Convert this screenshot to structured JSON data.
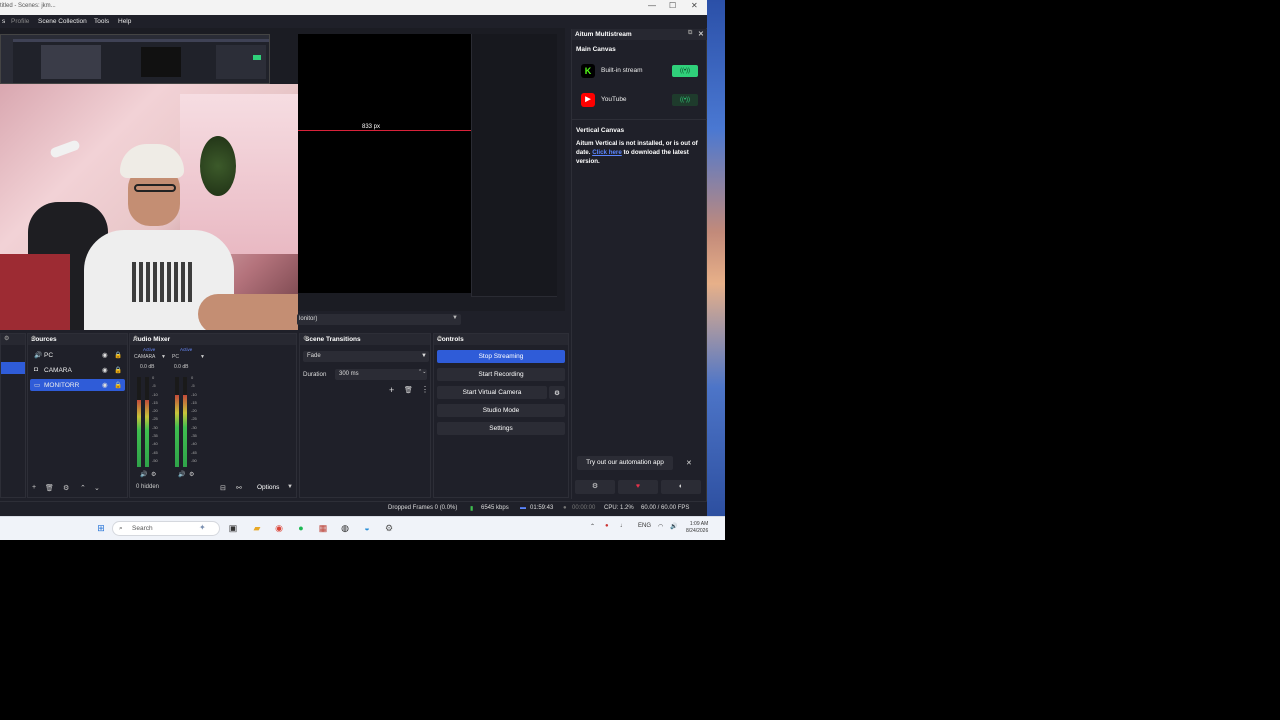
{
  "window": {
    "title": "titled - Scenes: jkm...",
    "controls": [
      "—",
      "☐",
      "✕"
    ]
  },
  "menu": {
    "profile": "Profile",
    "scene_collection": "Scene Collection",
    "tools": "Tools",
    "help": "Help"
  },
  "preview": {
    "px_label": "833 px",
    "monitor_select": "lonitor)"
  },
  "sources": {
    "title": "Sources",
    "items": [
      {
        "icon": "speaker-icon",
        "label": "PC"
      },
      {
        "icon": "camera-icon",
        "label": "CAMARA"
      },
      {
        "icon": "monitor-icon",
        "label": "MONITORR"
      }
    ]
  },
  "mixer": {
    "title": "Audio Mixer",
    "channels": [
      {
        "name": "CAMARA",
        "status": "Active",
        "db": "0.0 dB",
        "level": 0.75
      },
      {
        "name": "PC",
        "status": "Active",
        "db": "0.0 dB",
        "level": 0.8
      }
    ],
    "ticks": [
      "0",
      "-5",
      "-10",
      "-15",
      "-20",
      "-25",
      "-30",
      "-35",
      "-40",
      "-45",
      "-50",
      "-55",
      "-60"
    ],
    "hidden_label": "0 hidden",
    "options_label": "Options"
  },
  "transitions": {
    "title": "Scene Transitions",
    "type": "Fade",
    "duration_label": "Duration",
    "duration_value": "300 ms"
  },
  "controls": {
    "title": "Controls",
    "stop_streaming": "Stop Streaming",
    "start_recording": "Start Recording",
    "start_virtual_camera": "Start Virtual Camera",
    "studio_mode": "Studio Mode",
    "settings": "Settings"
  },
  "aitum": {
    "title": "Aitum Multistream",
    "main_canvas": "Main Canvas",
    "platforms": [
      {
        "icon": "kick-icon",
        "name": "Built-in stream",
        "toggle_color": "#2fd07a"
      },
      {
        "icon": "youtube-icon",
        "name": "YouTube",
        "toggle_color": "#1e3b2c"
      }
    ],
    "vertical_canvas": "Vertical Canvas",
    "vc_notice": "Aitum Vertical is not installed, or is out of date.",
    "vc_link": "Click here",
    "vc_tail": "to download the latest version.",
    "automation": "Try out our automation app"
  },
  "status": {
    "dropped_frames": "Dropped Frames 0 (0.0%)",
    "bitrate": "6545 kbps",
    "stream_time": "01:59:43",
    "record_time": "00:00:00",
    "cpu": "CPU: 1.2%",
    "fps": "60.00 / 60.00 FPS"
  },
  "taskbar": {
    "search_placeholder": "Search",
    "lang": "ENG",
    "time": "1:09 AM",
    "date": "8/24/2026"
  },
  "colors": {
    "accent": "#2f5cd8",
    "live_red": "#d8223a",
    "kick_green": "#53fc18",
    "youtube_red": "#ff0000"
  }
}
